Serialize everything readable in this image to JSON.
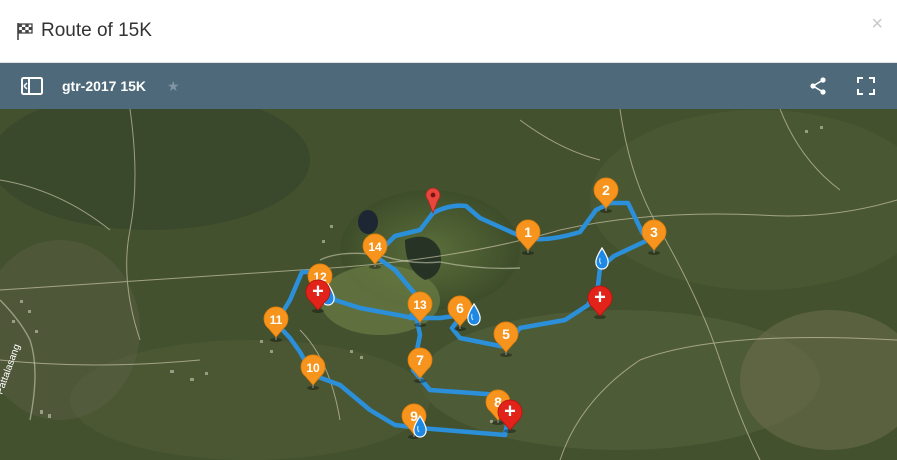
{
  "modal": {
    "title": "Route of 15K",
    "close_symbol": "×"
  },
  "toolbar": {
    "map_name": "gtr-2017 15K",
    "star_symbol": "★",
    "icons": [
      "panel-toggle-icon",
      "share-icon",
      "fullscreen-icon"
    ]
  },
  "map": {
    "place_label": "Pattalasang",
    "colors": {
      "route": "#2b90d9",
      "km_marker": "#f7941d",
      "first_aid_marker": "#e2231a",
      "water": "#1e88e5",
      "start_marker": "#e8463c"
    },
    "km_markers": [
      "1",
      "2",
      "3",
      "5",
      "6",
      "7",
      "8",
      "9",
      "10",
      "11",
      "12",
      "13",
      "14"
    ],
    "first_aid_symbol": "+",
    "legend_icons": [
      "km-marker-icon",
      "first-aid-icon",
      "water-station-icon",
      "start-pin-icon"
    ]
  }
}
